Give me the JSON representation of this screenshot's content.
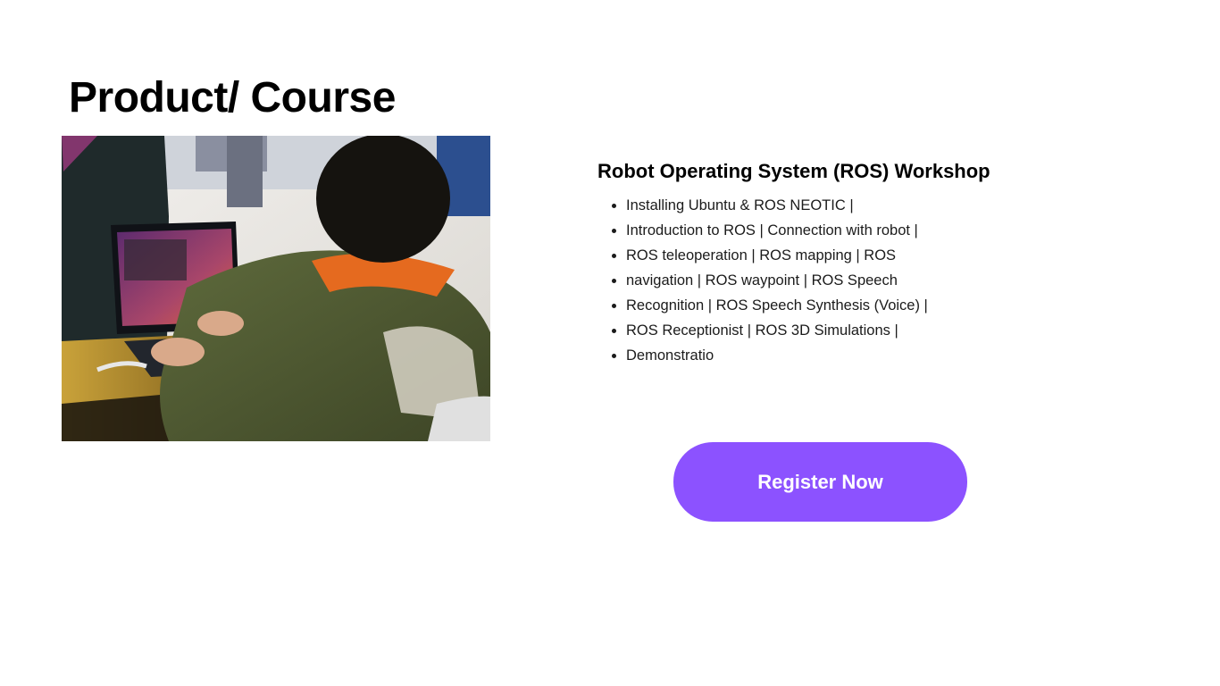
{
  "page": {
    "title": "Product/ Course"
  },
  "course": {
    "title": "Robot Operating System (ROS) Workshop",
    "topics": [
      "Installing Ubuntu & ROS NEOTIC |",
      "Introduction to ROS | Connection with robot |",
      "ROS teleoperation | ROS mapping | ROS",
      "navigation | ROS waypoint | ROS Speech",
      "Recognition | ROS Speech Synthesis (Voice) |",
      "ROS Receptionist | ROS 3D Simulations |",
      "Demonstratio"
    ]
  },
  "actions": {
    "register_label": "Register Now"
  },
  "colors": {
    "accent": "#8c52ff",
    "text": "#000000",
    "background": "#ffffff"
  }
}
